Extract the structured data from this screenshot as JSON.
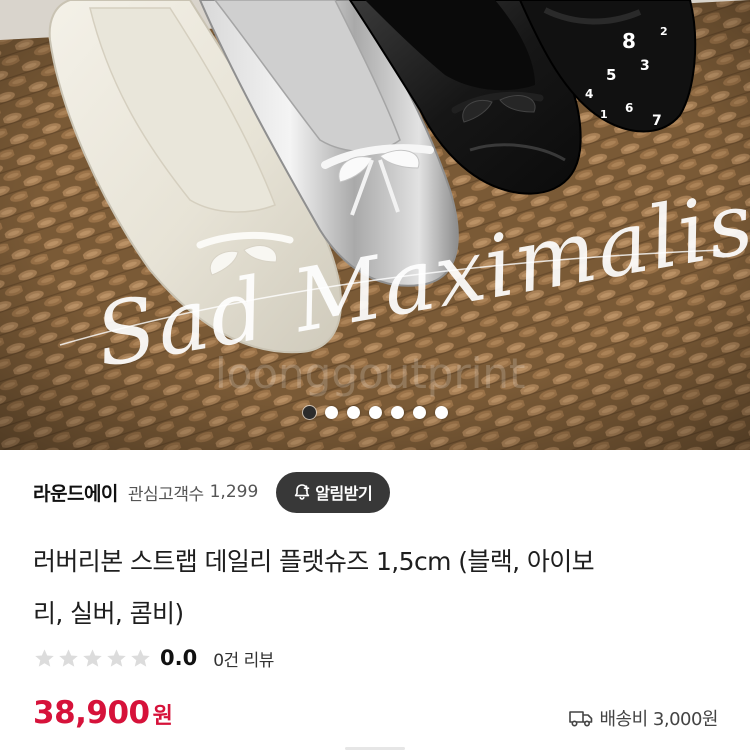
{
  "hero": {
    "watermark_script": "Sad Maximalist",
    "watermark_faint": "loonggoutprint",
    "shoe_digits": [
      "8",
      "5",
      "3",
      "4",
      "7",
      "6",
      "1",
      "2"
    ],
    "carousel": {
      "total": 7,
      "active_index": 0
    }
  },
  "seller": {
    "name": "라운드에이",
    "fav_label": "관심고객수",
    "fav_count": "1,299",
    "alert_button": "알림받기"
  },
  "product": {
    "title_line1": "러버리본 스트랩 데일리 플랫슈즈 1,5cm (블랙, 아이보",
    "title_line2": "리, 실버, 콤비)"
  },
  "rating": {
    "value": "0.0",
    "stars_max": 5,
    "stars_filled": 0,
    "review_count": "0건 리뷰"
  },
  "price": {
    "amount": "38,900",
    "currency": "원"
  },
  "shipping": {
    "label": "배송비 3,000원",
    "icon": "truck-icon"
  },
  "colors": {
    "price_red": "#d6123a",
    "button_dark": "#383838",
    "star_empty": "#dcdcdc"
  }
}
